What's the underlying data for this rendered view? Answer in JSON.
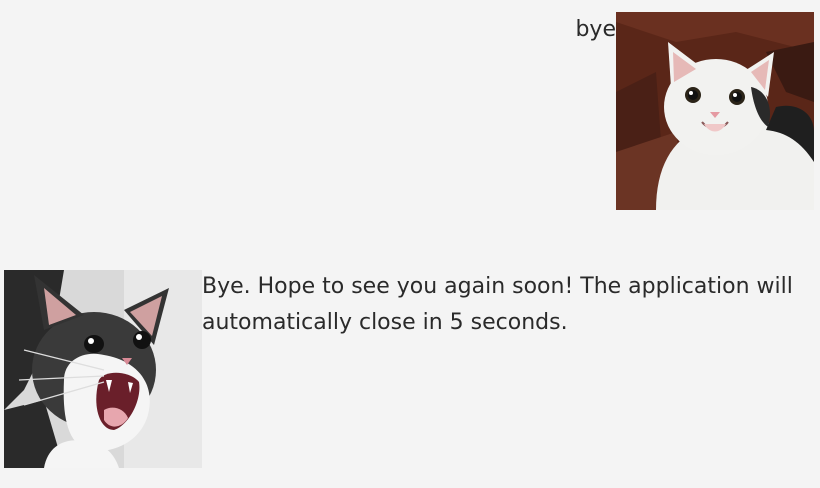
{
  "conversation": {
    "user_message": {
      "text": "bye",
      "avatar": "smiling-cat-avatar"
    },
    "bot_message": {
      "text": "Bye. Hope to see you again soon! The application will automatically close in 5 seconds.",
      "avatar": "screaming-cat-avatar"
    }
  }
}
